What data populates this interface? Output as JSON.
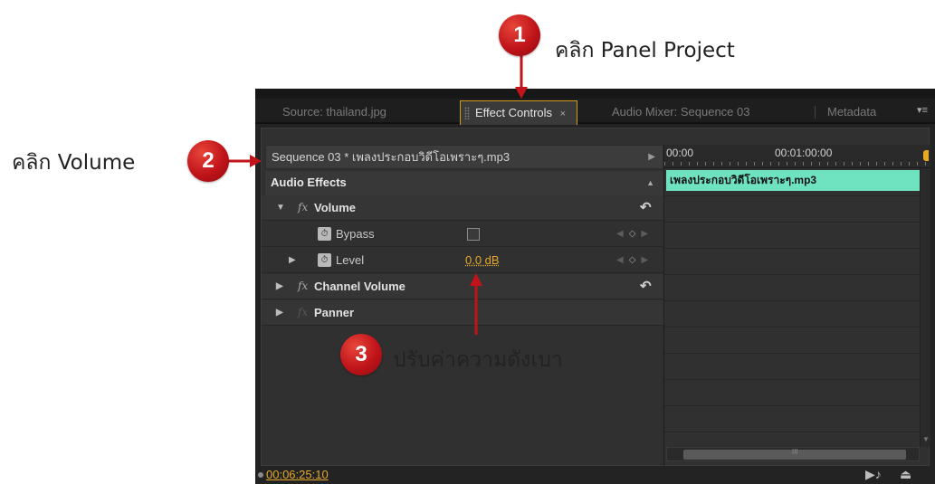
{
  "annotations": {
    "step1": {
      "number": "1",
      "text": "คลิก Panel Project"
    },
    "step2": {
      "number": "2",
      "text": "คลิก Volume"
    },
    "step3": {
      "number": "3",
      "text": "ปรับค่าความดังเบา"
    }
  },
  "tabs": [
    {
      "label": "Source: thailand.jpg",
      "active": false
    },
    {
      "label": "Effect Controls",
      "active": true,
      "close": "×"
    },
    {
      "label": "Audio Mixer: Sequence 03",
      "active": false
    },
    {
      "label": "Metadata",
      "active": false
    }
  ],
  "panel_menu_icon": "▾≡",
  "sequence": {
    "label": "Sequence 03 * เพลงประกอบวิดีโอเพราะๆ.mp3",
    "play_icon": "▶"
  },
  "section": {
    "label": "Audio Effects",
    "caret": "▲"
  },
  "effects": {
    "volume": {
      "label": "Volume",
      "fx": "fx",
      "expanded": true
    },
    "bypass": {
      "label": "Bypass"
    },
    "level": {
      "label": "Level",
      "value": "0.0 dB"
    },
    "channel_volume": {
      "label": "Channel Volume",
      "fx": "fx"
    },
    "panner": {
      "label": "Panner",
      "fx": "fx"
    }
  },
  "timeline": {
    "time_start": "00:00",
    "time_mark": "00:01:00:00",
    "clip": "เพลงประกอบวิดีโอเพราะๆ.mp3",
    "clip_color": "#6fe3c0",
    "scroll_thumb": "III"
  },
  "footer": {
    "timecode": "00:06:25:10"
  },
  "colors": {
    "accent": "#e4a92b",
    "callout": "#c0141a"
  }
}
